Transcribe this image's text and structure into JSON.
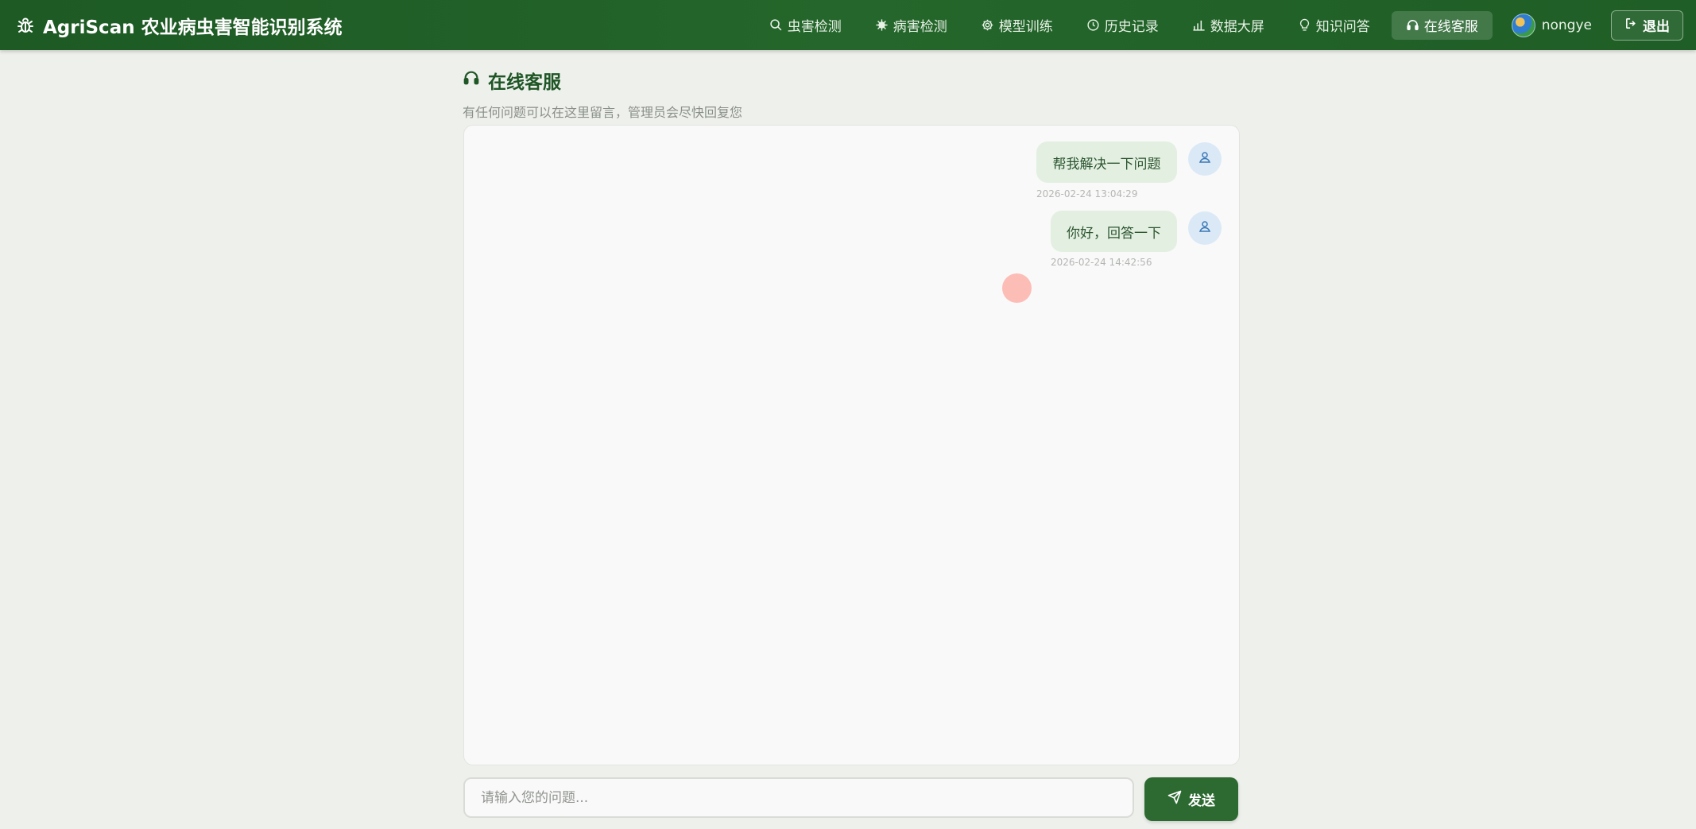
{
  "brand": {
    "title": "AgriScan 农业病虫害智能识别系统"
  },
  "nav": {
    "items": [
      {
        "label": "虫害检测",
        "icon": "search-icon"
      },
      {
        "label": "病害检测",
        "icon": "virus-icon"
      },
      {
        "label": "模型训练",
        "icon": "gear-icon"
      },
      {
        "label": "历史记录",
        "icon": "clock-icon"
      },
      {
        "label": "数据大屏",
        "icon": "bar-chart-icon"
      },
      {
        "label": "知识问答",
        "icon": "lightbulb-icon"
      },
      {
        "label": "在线客服",
        "icon": "headset-icon",
        "active": true
      }
    ],
    "username": "nongye",
    "logout_label": "退出"
  },
  "page": {
    "title": "在线客服",
    "subtitle": "有任何问题可以在这里留言，管理员会尽快回复您"
  },
  "messages": [
    {
      "text": "帮我解决一下问题",
      "time": "2026-02-24 13:04:29"
    },
    {
      "text": "你好，回答一下",
      "time": "2026-02-24 14:42:56"
    }
  ],
  "composer": {
    "placeholder": "请输入您的问题...",
    "send_label": "发送"
  },
  "colors": {
    "nav_bg": "#1f5e26",
    "accent": "#2d6a31",
    "bubble_bg": "#e3f0e1",
    "avatar_bg": "#dbe9f7"
  }
}
